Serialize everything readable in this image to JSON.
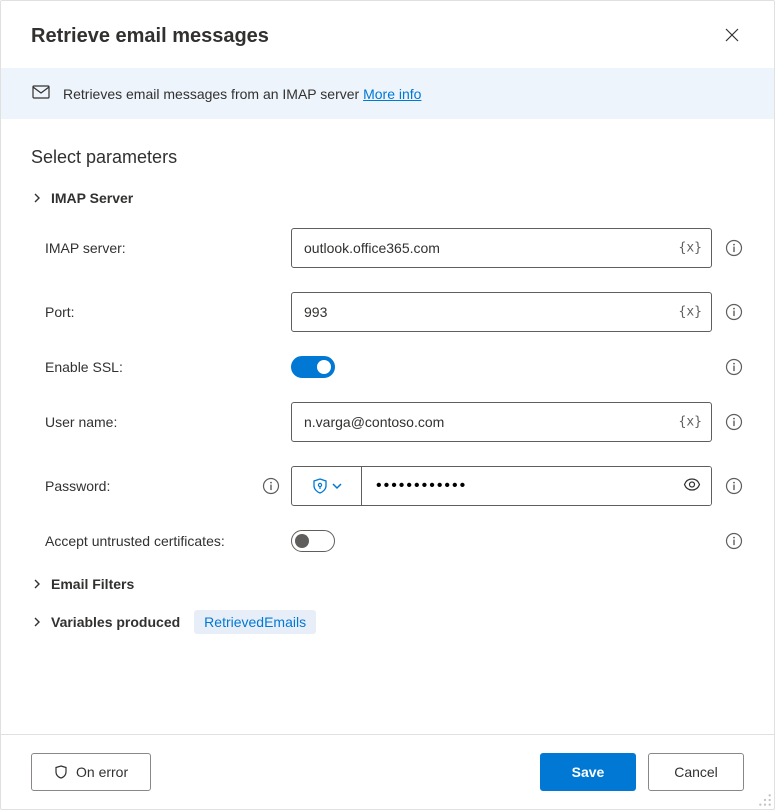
{
  "header": {
    "title": "Retrieve email messages"
  },
  "banner": {
    "text": "Retrieves email messages from an IMAP server ",
    "link": "More info"
  },
  "body": {
    "section_title": "Select parameters",
    "imap_section": {
      "header": "IMAP Server",
      "fields": {
        "server_label": "IMAP server:",
        "server_value": "outlook.office365.com",
        "port_label": "Port:",
        "port_value": "993",
        "ssl_label": "Enable SSL:",
        "ssl_on": true,
        "username_label": "User name:",
        "username_value": "n.varga@contoso.com",
        "password_label": "Password:",
        "password_value": "••••••••••••",
        "accept_cert_label": "Accept untrusted certificates:",
        "accept_cert_on": false,
        "var_token": "{x}"
      }
    },
    "filters_section": {
      "header": "Email Filters"
    },
    "vars_section": {
      "header": "Variables produced",
      "badge": "RetrievedEmails"
    }
  },
  "footer": {
    "on_error": "On error",
    "save": "Save",
    "cancel": "Cancel"
  }
}
